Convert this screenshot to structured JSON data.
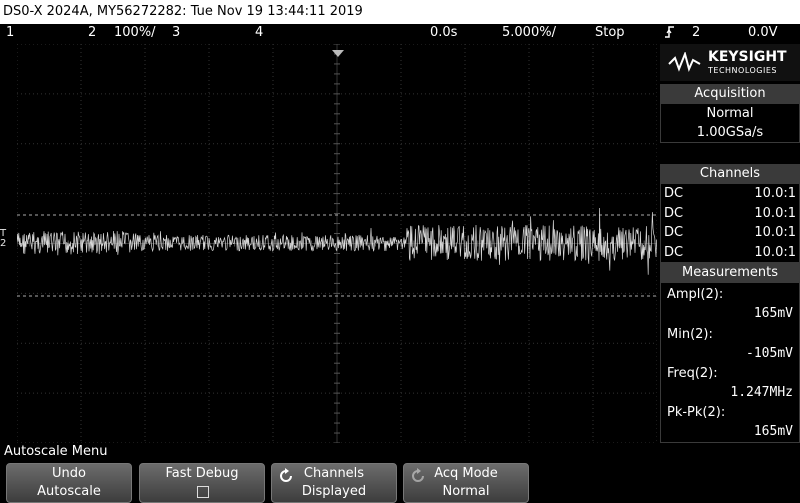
{
  "title": "DS0-X 2024A, MY56272282: Tue Nov 19 13:44:11 2019",
  "status": {
    "ch1": "1",
    "ch2": "2",
    "ch2_scale": "100%/",
    "ch3": "3",
    "ch4": "4",
    "time_offset": "0.0s",
    "time_scale": "5.000%/",
    "run_state": "Stop",
    "trigger_icon": "trigger-edge-icon",
    "trigger_channel": "2",
    "trigger_level": "0.0V"
  },
  "waveform": {
    "ch_label": "2",
    "trigger_marker": "T"
  },
  "panel": {
    "brand": "KEYSIGHT",
    "brand_sub": "TECHNOLOGIES",
    "acquisition": {
      "header": "Acquisition",
      "mode": "Normal",
      "rate": "1.00GSa/s"
    },
    "channels": {
      "header": "Channels",
      "rows": [
        {
          "coupling": "DC",
          "probe": "10.0:1"
        },
        {
          "coupling": "DC",
          "probe": "10.0:1"
        },
        {
          "coupling": "DC",
          "probe": "10.0:1"
        },
        {
          "coupling": "DC",
          "probe": "10.0:1"
        }
      ]
    },
    "measurements": {
      "header": "Measurements",
      "items": [
        {
          "label": "Ampl(2):",
          "value": "165mV"
        },
        {
          "label": "Min(2):",
          "value": "-105mV"
        },
        {
          "label": "Freq(2):",
          "value": "1.247MHz"
        },
        {
          "label": "Pk-Pk(2):",
          "value": "165mV"
        }
      ]
    }
  },
  "menu": {
    "title": "Autoscale Menu",
    "softkeys": [
      {
        "line1": "Undo",
        "line2": "Autoscale"
      },
      {
        "line1": "Fast Debug",
        "line2": ""
      },
      {
        "line1": "Channels",
        "line2": "Displayed"
      },
      {
        "line1": "Acq Mode",
        "line2": "Normal"
      }
    ]
  }
}
